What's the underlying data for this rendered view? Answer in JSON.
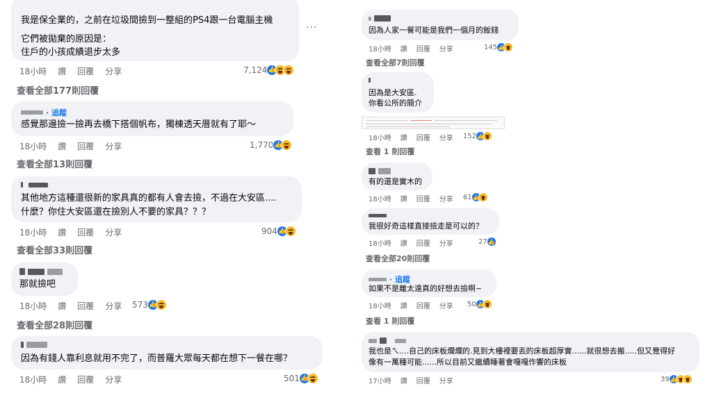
{
  "actions": {
    "time_18": "18小時",
    "time_17": "17小時",
    "like": "讚",
    "reply": "回覆",
    "share": "分享"
  },
  "left": {
    "c1": {
      "lines": [
        "我是保全業的，之前在垃圾間撿到一整組的PS4跟一台電腦主機",
        "它們被拋棄的原因是：",
        "住戶的小孩成績退步太多"
      ],
      "count": "7,124",
      "view": "查看全部177則回覆",
      "reactions": [
        "like",
        "haha",
        "wow"
      ]
    },
    "c2": {
      "follow": "· 追蹤",
      "lines": [
        "感覺那邊撿一撿再去橋下搭個帆布，獨棟透天厝就有了耶～"
      ],
      "count": "1,770",
      "view": "查看全部13則回覆",
      "reactions": [
        "like",
        "haha"
      ]
    },
    "c3": {
      "lines": [
        "其他地方這種還很新的家具真的都有人會去撿，不過在大安區....",
        "什麼？你住大安區還在撿別人不要的家具？？？"
      ],
      "count": "904",
      "view": "查看全部33則回覆",
      "reactions": [
        "like",
        "haha"
      ]
    },
    "c4": {
      "lines": [
        "那就撿吧"
      ],
      "count": "573",
      "view": "查看全部28則回覆",
      "reactions": [
        "like",
        "haha"
      ]
    },
    "c5": {
      "lines": [
        "因為有錢人靠利息就用不完了，而普羅大眾每天都在想下一餐在哪？"
      ],
      "count": "501",
      "reactions": [
        "like",
        "sad"
      ]
    }
  },
  "right": {
    "c1": {
      "lines": [
        "因為人家一餐可能是我們一個月的飯錢"
      ],
      "count": "145",
      "view": "查看全部7則回覆",
      "reactions": [
        "like",
        "haha"
      ]
    },
    "c2": {
      "lines": [
        "因為是大安區.",
        "你看公所的簡介"
      ],
      "count": "152",
      "view": "查看 1 則回覆",
      "reactions": [
        "like",
        "haha"
      ]
    },
    "c3": {
      "lines": [
        "有的還是實木的"
      ],
      "count": "61",
      "reactions": [
        "like",
        "haha"
      ]
    },
    "c4": {
      "lines": [
        "我很好奇這樣直接撿走是可以的？"
      ],
      "count": "27",
      "view": "查看全部20則回覆",
      "reactions": [
        "like"
      ]
    },
    "c5": {
      "follow": "· 追蹤",
      "lines": [
        "如果不是離太遠真的好想去撿啊~"
      ],
      "count": "50",
      "view": "查看 1 則回覆",
      "reactions": [
        "like",
        "haha"
      ]
    },
    "c6": {
      "lines": [
        "我也是ㄟ....自己的床板爛爛的.見到大樓裡要丟的床板超厚實......就很想去搬.....但又覺得好",
        "像有一萬種可能......所以目前又繼續睡著會嘎嘎作響的床板"
      ],
      "count": "39",
      "reactions": [
        "like",
        "haha",
        "wow"
      ]
    }
  }
}
